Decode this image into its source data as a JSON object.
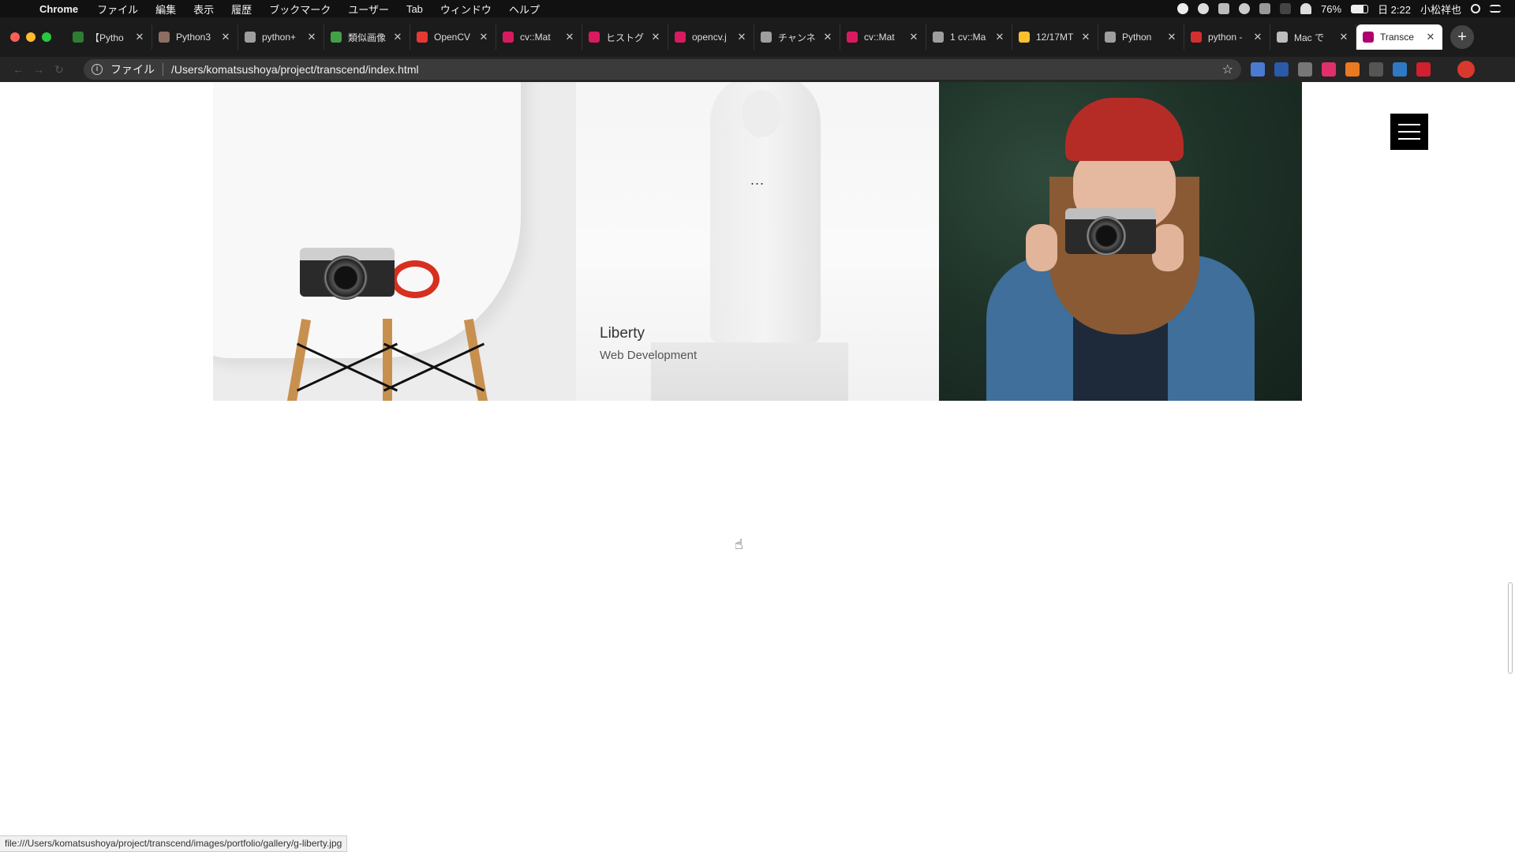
{
  "menubar": {
    "app_name": "Chrome",
    "items": [
      "ファイル",
      "編集",
      "表示",
      "履歴",
      "ブックマーク",
      "ユーザー",
      "Tab",
      "ウィンドウ",
      "ヘルプ"
    ],
    "battery": "76%",
    "clock": "日 2:22",
    "user": "小松祥也"
  },
  "tabs": [
    {
      "title": "【Pytho",
      "color": "#2e7d32"
    },
    {
      "title": "Python3",
      "color": "#8d6e63"
    },
    {
      "title": "python+",
      "color": "#9e9e9e"
    },
    {
      "title": "類似画像",
      "color": "#43a047"
    },
    {
      "title": "OpenCV",
      "color": "#e53935"
    },
    {
      "title": "cv::Mat",
      "color": "#d81b60"
    },
    {
      "title": "ヒストグ",
      "color": "#d81b60"
    },
    {
      "title": "opencv.j",
      "color": "#d81b60"
    },
    {
      "title": "チャンネ",
      "color": "#9e9e9e"
    },
    {
      "title": "cv::Mat",
      "color": "#d81b60"
    },
    {
      "title": "1 cv::Ma",
      "color": "#9e9e9e"
    },
    {
      "title": "12/17MT",
      "color": "#fbc02d"
    },
    {
      "title": "Python",
      "color": "#9e9e9e"
    },
    {
      "title": "python -",
      "color": "#d32f2f"
    },
    {
      "title": "Mac で",
      "color": "#bdbdbd"
    },
    {
      "title": "Transce",
      "color": "#b0006f",
      "active": true
    }
  ],
  "omnibox": {
    "scheme_label": "ファイル",
    "url": "/Users/komatsushoya/project/transcend/index.html"
  },
  "extensions": [
    "#4a7bd0",
    "#2a5aa8",
    "#777777",
    "#e0306b",
    "#e97a1f",
    "#555555",
    "#2f79c4",
    "#d01f2f"
  ],
  "profile_color": "#d9382e",
  "gallery": {
    "liberty": {
      "title": "Liberty",
      "subtitle": "Web Development",
      "dots": "..."
    }
  },
  "statusbar": {
    "link": "file:///Users/komatsushoya/project/transcend/images/portfolio/gallery/g-liberty.jpg"
  }
}
